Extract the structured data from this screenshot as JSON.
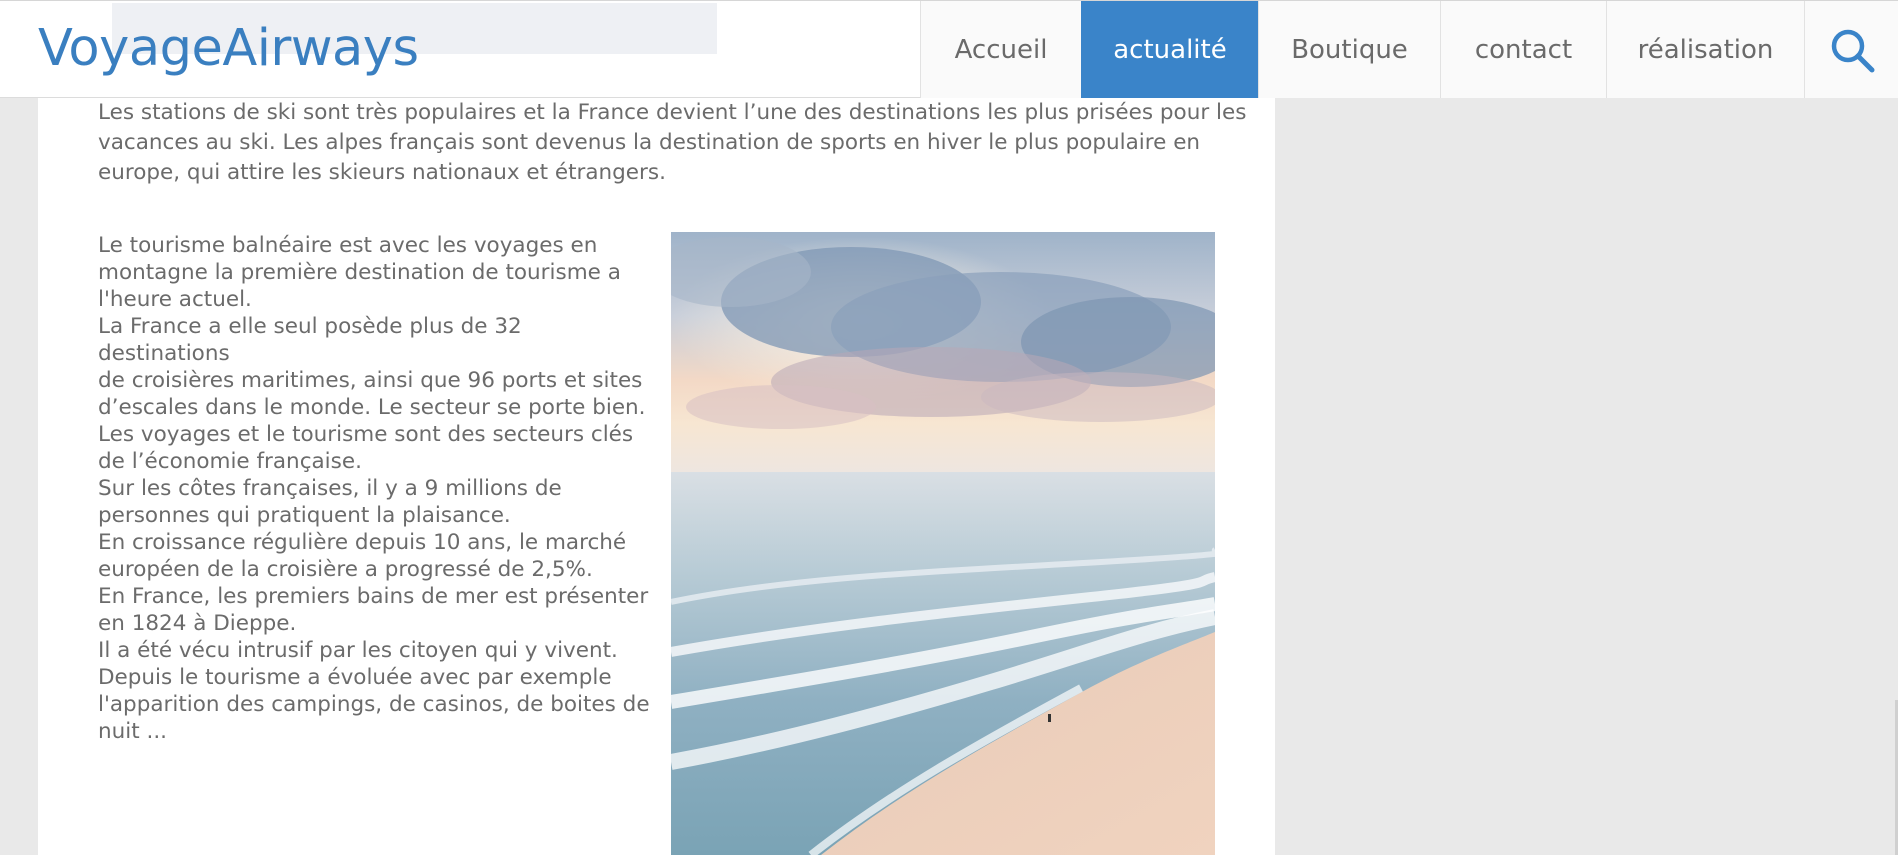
{
  "header": {
    "logo": "VoyageAirways",
    "nav": {
      "accueil": "Accueil",
      "actualite": "actualité",
      "boutique": "Boutique",
      "contact": "contact",
      "realisation": "réalisation"
    },
    "search_icon": "search-icon"
  },
  "main": {
    "intro": "Les stations de ski sont très populaires et la France devient l’une des destinations les plus prisées pour les\nvacances au ski. Les alpes français sont devenus la destination de sports en hiver le plus populaire en\neurope, qui attire les skieurs nationaux et étrangers.",
    "body": "Le tourisme balnéaire est avec les voyages en\nmontagne la première destination de tourisme a\nl'heure actuel.\nLa France a elle seul posède plus de 32 destinations\nde croisières maritimes, ainsi que 96 ports et sites\nd’escales dans le monde. Le secteur se porte bien.\nLes voyages et le tourisme sont des secteurs clés\nde l’économie française.\nSur les côtes françaises, il y a 9 millions de\npersonnes qui pratiquent la plaisance.\nEn croissance régulière depuis 10 ans, le marché\neuropéen de la croisière a progressé de 2,5%.\nEn France, les premiers bains de mer est présenter\nen 1824 à Dieppe.\nIl a été vécu intrusif par les citoyen qui y vivent.\nDepuis le tourisme a évoluée avec par exemple\nl'apparition des campings, de casinos, de boites de\nnuit ..."
  },
  "colors": {
    "accent": "#3a84c9",
    "logo": "#3a7fc0",
    "text": "#6b6b6b",
    "background": "#e9e9e9"
  }
}
